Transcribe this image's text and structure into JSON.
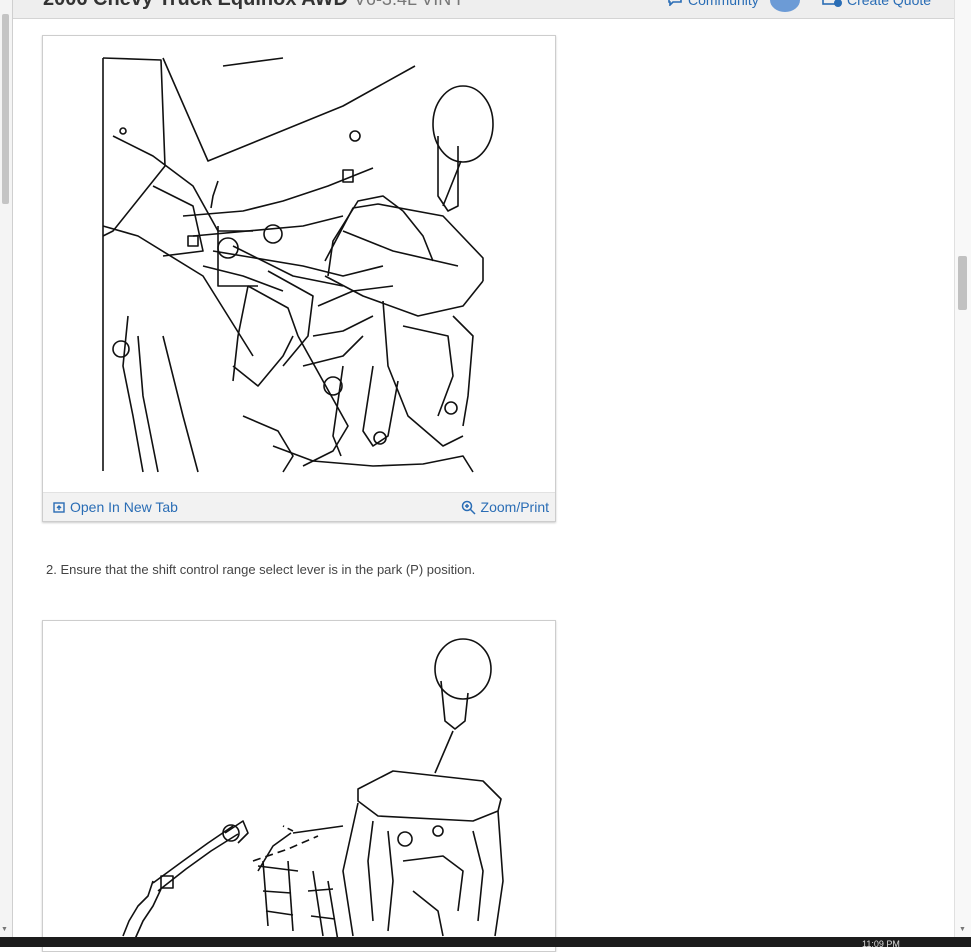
{
  "header": {
    "title": "2006 Chevy Truck Equinox AWD",
    "engine": "V6-3.4L VIN F",
    "community_label": "Community",
    "create_quote_label": "Create Quote"
  },
  "figure1": {
    "open_new_tab_label": "Open In New Tab",
    "zoom_print_label": "Zoom/Print"
  },
  "steps": [
    {
      "text": "2. Ensure that the shift control range select lever is in the park (P) position."
    }
  ],
  "clock": {
    "time": "11:09 PM"
  },
  "icons": {
    "open_tab": "open-new-tab-icon",
    "zoom": "zoom-icon",
    "community": "community-icon",
    "quote": "create-quote-icon"
  },
  "colors": {
    "link": "#2a6db5",
    "header_bg": "#eeeeee"
  }
}
